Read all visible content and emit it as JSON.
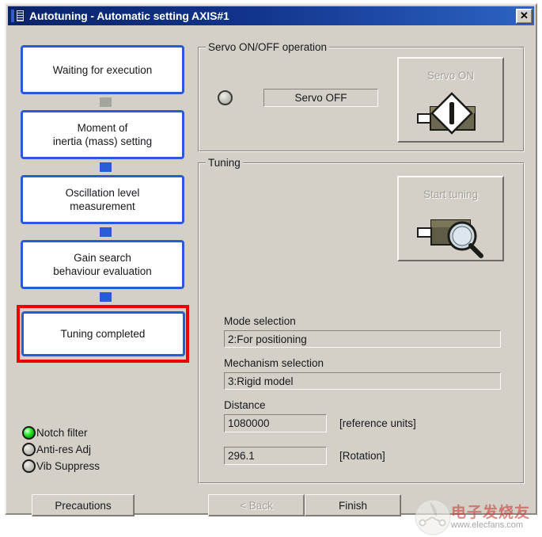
{
  "window": {
    "title": "Autotuning - Automatic setting AXIS#1",
    "icon": "autotuning-app-icon",
    "close_label": "✕"
  },
  "flow": {
    "steps": [
      {
        "label": "Waiting for execution",
        "highlighted": false
      },
      {
        "label": "Moment of\ninertia (mass) setting",
        "highlighted": false
      },
      {
        "label": "Oscillation level\nmeasurement",
        "highlighted": false
      },
      {
        "label": "Gain search\nbehaviour evaluation",
        "highlighted": false
      },
      {
        "label": "Tuning completed",
        "highlighted": true
      }
    ],
    "connectors": [
      "gray",
      "blue",
      "blue",
      "blue"
    ]
  },
  "indicators": [
    {
      "label": "Notch filter",
      "state": "on"
    },
    {
      "label": "Anti-res Adj",
      "state": "off"
    },
    {
      "label": "Vib Suppress",
      "state": "off"
    }
  ],
  "servo_group": {
    "title": "Servo ON/OFF operation",
    "status_value": "Servo OFF",
    "button_label": "Servo ON",
    "button_icon": "servo-motor-power-icon",
    "button_enabled": false
  },
  "tuning_group": {
    "title": "Tuning",
    "button_label": "Start tuning",
    "button_icon": "servo-motor-magnifier-icon",
    "button_enabled": false,
    "fields": [
      {
        "label": "Mode selection",
        "value": "2:For positioning",
        "unit": ""
      },
      {
        "label": "Mechanism selection",
        "value": "3:Rigid model",
        "unit": ""
      },
      {
        "label": "Distance",
        "value": "1080000",
        "unit": "[reference units]"
      },
      {
        "label": "",
        "value": "296.1",
        "unit": "[Rotation]"
      }
    ]
  },
  "footer": {
    "precautions_label": "Precautions",
    "back_label": "< Back",
    "back_enabled": false,
    "finish_label": "Finish"
  },
  "watermark": {
    "text": "电子发烧友",
    "url": "www.elecfans.com"
  },
  "colors": {
    "dialog_face": "#d4d0c8",
    "title_blue": "#0a246a",
    "flow_border": "#2a5bd7",
    "highlight_red": "#ef0000",
    "led_on_green": "#2bf12b"
  }
}
